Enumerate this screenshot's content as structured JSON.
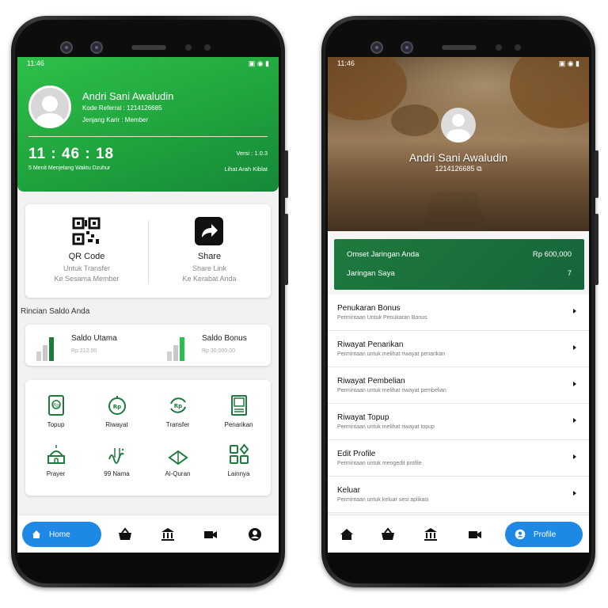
{
  "status": {
    "time": "11:46"
  },
  "home": {
    "profile": {
      "name": "Andri Sani Awaludin",
      "kode_referral": "Kode Referral : 1214126685",
      "jenjang_karir": "Jenjang Karir : Member"
    },
    "clock": {
      "time": "11 : 46 : 18",
      "subtitle": "5 Menit Menjelang Waktu Dzuhur",
      "version": "Versi : 1.0.3",
      "kiblat": "Lihat Arah Kiblat"
    },
    "quick_actions": [
      {
        "title": "QR Code",
        "line1": "Untuk Transfer",
        "line2": "Ke Sesama Member",
        "icon": "qr-code-icon"
      },
      {
        "title": "Share",
        "line1": "Share Link",
        "line2": "Ke Kerabat Anda",
        "icon": "share-icon"
      }
    ],
    "saldo_section": "Rincian Saldo Anda",
    "saldo": [
      {
        "title": "Saldo Utama",
        "value": "Rp 212.00"
      },
      {
        "title": "Saldo Bonus",
        "value": "Rp 30,000.00"
      }
    ],
    "menu": [
      {
        "label": "Topup",
        "icon": "topup-icon"
      },
      {
        "label": "Riwayat",
        "icon": "riwayat-icon"
      },
      {
        "label": "Transfer",
        "icon": "transfer-icon"
      },
      {
        "label": "Penarikan",
        "icon": "penarikan-icon"
      },
      {
        "label": "Prayer",
        "icon": "mosque-icon"
      },
      {
        "label": "99 Nama",
        "icon": "asmaul-husna-icon"
      },
      {
        "label": "Al-Quran",
        "icon": "quran-icon"
      },
      {
        "label": "Lainnya",
        "icon": "more-grid-icon"
      }
    ],
    "nav": {
      "active_label": "Home"
    }
  },
  "profile_page": {
    "name": "Andri Sani Awaludin",
    "code": "1214126685",
    "omset": {
      "label": "Omset Jaringan Anda",
      "value": "Rp 600,000"
    },
    "jaringan": {
      "label": "Jaringan Saya",
      "value": "7"
    },
    "list": [
      {
        "title": "Penukaran Bonus",
        "subtitle": "Permintaan Untuk Penukaran Bonus"
      },
      {
        "title": "Riwayat Penarikan",
        "subtitle": "Permintaan untuk melihat riwayat penarikan"
      },
      {
        "title": "Riwayat Pembelian",
        "subtitle": "Permintaan untuk melihat riwayat pembelian"
      },
      {
        "title": "Riwayat Topup",
        "subtitle": "Permintaan untuk melihat riwayat topup"
      },
      {
        "title": "Edit Profile",
        "subtitle": "Permintaan untuk mengedit profile"
      },
      {
        "title": "Keluar",
        "subtitle": "Permintaan untuk keluar sesi aplikasi"
      }
    ],
    "nav": {
      "active_label": "Profile"
    }
  },
  "colors": {
    "brand_green": "#22a844",
    "dark_green": "#1a6e3c",
    "nav_blue": "#1e88e5"
  }
}
